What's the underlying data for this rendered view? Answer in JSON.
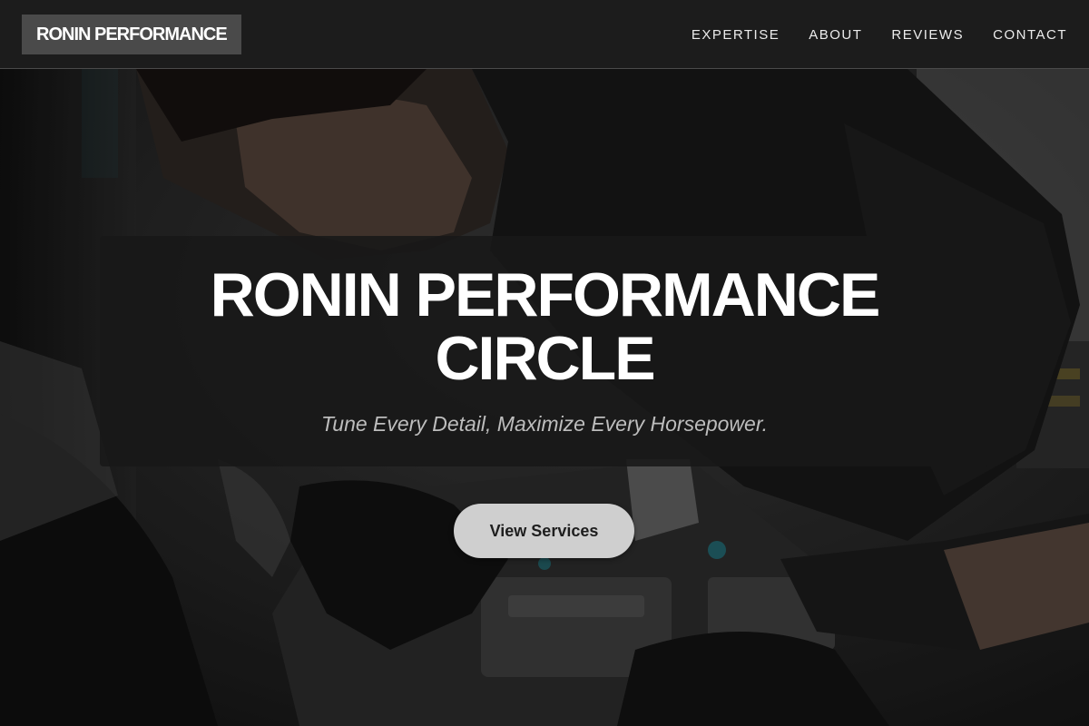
{
  "brand": {
    "logo_text": "RONIN PERFORMANCE"
  },
  "nav": {
    "items": [
      {
        "label": "EXPERTISE"
      },
      {
        "label": "ABOUT"
      },
      {
        "label": "REVIEWS"
      },
      {
        "label": "CONTACT"
      }
    ]
  },
  "hero": {
    "title": "RONIN PERFORMANCE CIRCLE",
    "subtitle": "Tune Every Detail, Maximize Every Horsepower.",
    "cta_label": "View Services",
    "background_icon": "mechanic-working-on-engine-photo"
  },
  "colors": {
    "navbar_bg": "#1c1c1c",
    "logo_bg": "#4a4a4a",
    "panel_bg": "#181818",
    "button_bg": "#cfcfcf",
    "text_primary": "#ffffff",
    "text_secondary": "#bdbdbd",
    "accent_teal": "#1f6e78"
  }
}
